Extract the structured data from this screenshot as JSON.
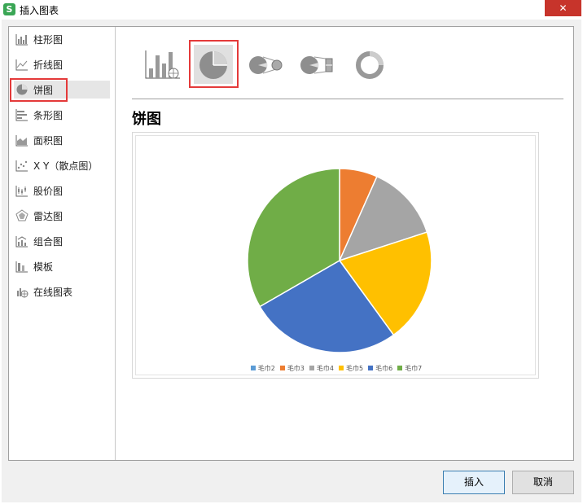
{
  "window": {
    "title": "插入图表",
    "close_label": "✕"
  },
  "sidebar": {
    "items": [
      {
        "label": "柱形图",
        "icon": "column-chart-icon"
      },
      {
        "label": "折线图",
        "icon": "line-chart-icon"
      },
      {
        "label": "饼图",
        "icon": "pie-chart-icon"
      },
      {
        "label": "条形图",
        "icon": "bar-chart-icon"
      },
      {
        "label": "面积图",
        "icon": "area-chart-icon"
      },
      {
        "label": "X Y（散点图）",
        "icon": "scatter-chart-icon"
      },
      {
        "label": "股价图",
        "icon": "stock-chart-icon"
      },
      {
        "label": "雷达图",
        "icon": "radar-chart-icon"
      },
      {
        "label": "组合图",
        "icon": "combo-chart-icon"
      },
      {
        "label": "模板",
        "icon": "template-icon"
      },
      {
        "label": "在线图表",
        "icon": "online-chart-icon"
      }
    ],
    "selected_index": 2
  },
  "subtypes": [
    {
      "icon": "column-chart-thumb-icon"
    },
    {
      "icon": "pie-subtype-icon",
      "selected": true
    },
    {
      "icon": "pie-of-pie-icon"
    },
    {
      "icon": "bar-of-pie-icon"
    },
    {
      "icon": "doughnut-icon"
    }
  ],
  "section": {
    "title": "饼图"
  },
  "chart_data": {
    "type": "pie",
    "categories": [
      "毛巾2",
      "毛巾3",
      "毛巾4",
      "毛巾5",
      "毛巾6",
      "毛巾7"
    ],
    "values": [
      0,
      7,
      14,
      21,
      28,
      35
    ],
    "colors": [
      "#5b9bd5",
      "#ed7d31",
      "#a5a5a5",
      "#ffc000",
      "#4472c4",
      "#70ad47"
    ],
    "title": "",
    "legend_position": "bottom"
  },
  "buttons": {
    "insert_label": "插入",
    "cancel_label": "取消"
  }
}
